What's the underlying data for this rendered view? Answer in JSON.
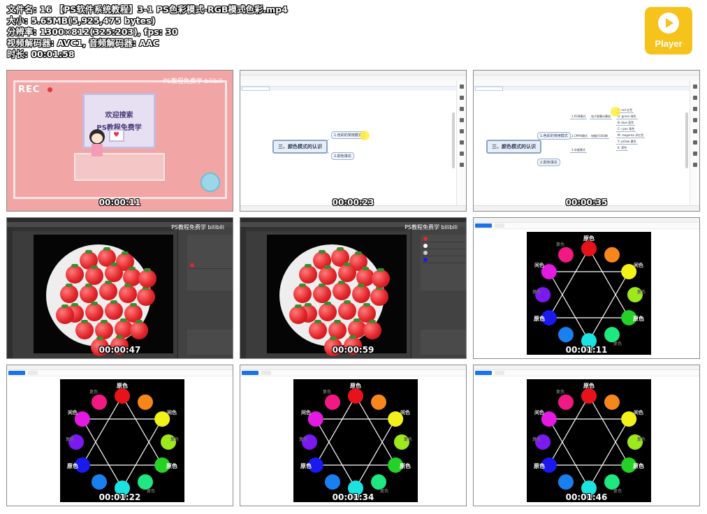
{
  "header": {
    "filename_line": "文件名: 16 【PS软件系统教程】3-1 PS色彩模式-RGB模式色彩.mp4",
    "size_line": "大小: 5.65MB(5,925,475 bytes)",
    "resolution_line": "分辨率: 1300×812(325:203), fps: 30",
    "codec_line": "视频解码器: AVC1, 音频解码器: AAC",
    "duration_line": "时长: 00:01:58"
  },
  "logo": {
    "label": "Player",
    "color": "#f6c21c"
  },
  "thumbnails": [
    {
      "timestamp": "00:00:11",
      "kind": "intro",
      "rec": "REC",
      "watermark": "PS教程免费学 bilibili",
      "screen_line1": "欢迎搜索",
      "screen_line2": "PS教程免费学"
    },
    {
      "timestamp": "00:00:23",
      "kind": "mindmap",
      "root": "三、颜色模式的认识",
      "branches": [
        "1.色彩的常用模式",
        "2.颜色填充"
      ]
    },
    {
      "timestamp": "00:00:35",
      "kind": "mindmap-expanded",
      "root": "三、颜色模式的认识",
      "branches": [
        "1.色彩的常用模式",
        "2.颜色填充"
      ],
      "sub": [
        "1.RGB模式",
        "2.CMYK模式",
        "3.灰度模式"
      ],
      "sub2": [
        "电子屏幕计算机",
        "电脑打印印刷"
      ],
      "leaves": [
        "R: red 红色",
        "G: green 绿色",
        "B: blue 蓝色",
        "C: cyan 青色",
        "M: magenta 洋红色",
        "Y: yellow 黄色",
        "K: 黑色"
      ]
    },
    {
      "timestamp": "00:00:47",
      "kind": "photoshop",
      "watermark": "PS教程免费学 bilibili"
    },
    {
      "timestamp": "00:00:59",
      "kind": "photoshop",
      "watermark": "PS教程免费学 bilibili"
    },
    {
      "timestamp": "00:01:11",
      "kind": "wheel"
    },
    {
      "timestamp": "00:01:22",
      "kind": "wheel"
    },
    {
      "timestamp": "00:01:34",
      "kind": "wheel"
    },
    {
      "timestamp": "00:01:46",
      "kind": "wheel"
    }
  ],
  "wheel": {
    "primary_label": "原色",
    "secondary_label": "间色",
    "tertiary_label": "复色",
    "colors": [
      "#e8131a",
      "#f7861c",
      "#f2f21a",
      "#9ee81e",
      "#25d126",
      "#1ee87f",
      "#1de3e0",
      "#1a80f0",
      "#1a1aee",
      "#7a1af0",
      "#e21ae2",
      "#f21a82"
    ]
  }
}
